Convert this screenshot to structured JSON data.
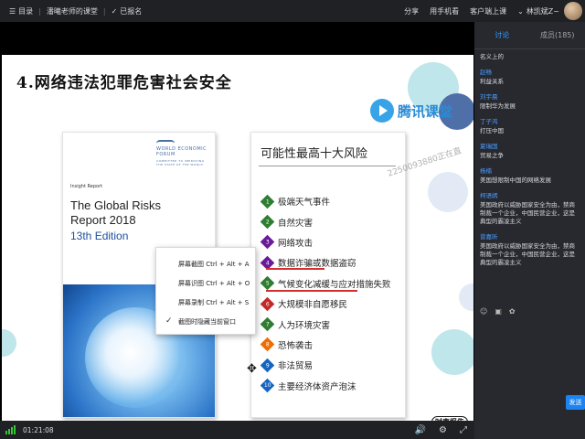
{
  "topbar": {
    "menu_label": "目录",
    "course_name": "潘曦老师的课堂",
    "enrolled_label": "已报名",
    "share_label": "分享",
    "phone_label": "用手机看",
    "client_label": "客户端上课",
    "user_name": "林凯斌Z~"
  },
  "slide": {
    "title": "4.网络违法犯罪危害社会安全",
    "logo_text": "腾讯课堂",
    "watermark": "2250093880正在直",
    "footer_logo": "时事报告"
  },
  "book": {
    "wef_text": "WORLD ECONOMIC FORUM",
    "wef_tagline": "COMMITTED TO IMPROVING THE STATE OF THE WORLD",
    "insight_report": "Insight Report",
    "title_line1": "The Global Risks",
    "title_line2": "Report 2018",
    "edition": "13th Edition"
  },
  "risk_panel": {
    "title": "可能性最高十大风险",
    "items": [
      {
        "num": "1",
        "label": "极端天气事件",
        "color": "#2e7d32"
      },
      {
        "num": "2",
        "label": "自然灾害",
        "color": "#2e7d32"
      },
      {
        "num": "3",
        "label": "网络攻击",
        "color": "#6a1b9a"
      },
      {
        "num": "4",
        "label": "数据诈骗或数据盗窃",
        "color": "#6a1b9a"
      },
      {
        "num": "5",
        "label": "气候变化减缓与应对措施失败",
        "color": "#2e7d32"
      },
      {
        "num": "6",
        "label": "大规模非自愿移民",
        "color": "#c62828"
      },
      {
        "num": "7",
        "label": "人为环境灾害",
        "color": "#2e7d32"
      },
      {
        "num": "8",
        "label": "恐怖袭击",
        "color": "#ef6c00"
      },
      {
        "num": "9",
        "label": "非法贸易",
        "color": "#1565c0"
      },
      {
        "num": "10",
        "label": "主要经济体资产泡沫",
        "color": "#1565c0"
      }
    ]
  },
  "context_menu": {
    "items": [
      {
        "label": "屏幕截图 Ctrl + Alt + A",
        "checked": false
      },
      {
        "label": "屏幕识图 Ctrl + Alt + O",
        "checked": false
      },
      {
        "label": "屏幕录制 Ctrl + Alt + S",
        "checked": false
      },
      {
        "label": "截图时隐藏当前窗口",
        "checked": true
      }
    ]
  },
  "bottombar": {
    "time": "01:21:08"
  },
  "sidebar": {
    "tab_discussion": "讨论",
    "tab_members": "成员(185)",
    "messages": [
      {
        "name": "",
        "text": "名义上的"
      },
      {
        "name": "赵畅",
        "text": "利益关系"
      },
      {
        "name": "刘宇晨",
        "text": "限制华为发展"
      },
      {
        "name": "丁子鸿",
        "text": "打压中国"
      },
      {
        "name": "夏瑞国",
        "text": "贸易之争"
      },
      {
        "name": "杨楠",
        "text": "美国想限制中国的网络发展"
      },
      {
        "name": "柯语嫣",
        "text": "美国政府以威胁国家安全为由，禁商制裁一个企业，中国民营企业，这是典型的霸凌主义"
      },
      {
        "name": "曾嘉昕",
        "text": "美国政府以威胁国家安全为由，禁商制裁一个企业，中国民营企业，这是典型的霸凌主义"
      }
    ],
    "send_label": "发送"
  },
  "colors": {
    "accent": "#3d9bff",
    "underline": "#d32f2f",
    "send": "#1b84f0"
  }
}
